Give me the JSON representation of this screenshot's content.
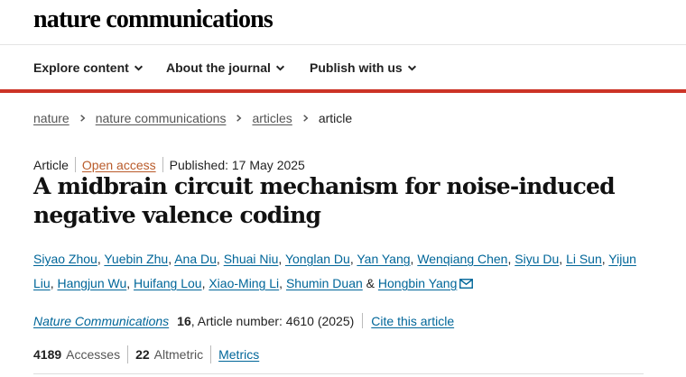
{
  "header": {
    "brand": "nature communications"
  },
  "nav": [
    {
      "label": "Explore content"
    },
    {
      "label": "About the journal"
    },
    {
      "label": "Publish with us"
    }
  ],
  "breadcrumb": [
    "nature",
    "nature communications",
    "articles",
    "article"
  ],
  "meta": {
    "type": "Article",
    "access": "Open access",
    "published": "Published: 17 May 2025"
  },
  "title": "A midbrain circuit mechanism for noise-induced negative valence coding",
  "authors": [
    "Siyao Zhou",
    "Yuebin Zhu",
    "Ana Du",
    "Shuai Niu",
    "Yonglan Du",
    "Yan Yang",
    "Wenqiang Chen",
    "Siyu Du",
    "Li Sun",
    "Yijun Liu",
    "Hangjun Wu",
    "Huifang Lou",
    "Xiao-Ming Li",
    "Shumin Duan",
    "Hongbin Yang"
  ],
  "citation": {
    "journal": "Nature Communications",
    "volume": "16",
    "article_number": ", Article number: 4610 (2025)",
    "cite_link": "Cite this article"
  },
  "metrics": {
    "accesses": "4189",
    "accesses_label": "Accesses",
    "altmetric": "22",
    "altmetric_label": "Altmetric",
    "metrics_link": "Metrics"
  },
  "colors": {
    "accent_red": "#cc3326",
    "link": "#006699",
    "open_access": "#b95b2a"
  }
}
